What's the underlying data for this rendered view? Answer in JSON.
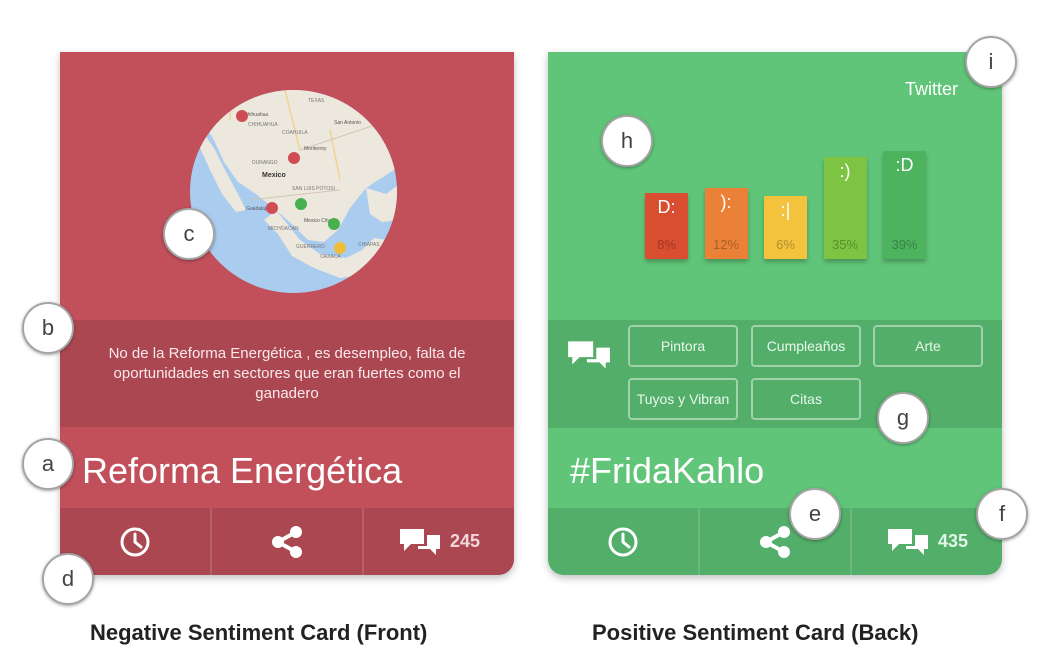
{
  "cards": {
    "negative": {
      "title": "Reforma Energética",
      "quote": "No de la Reforma Energética , es desempleo, falta de oportunidades en sectores que eran fuertes como el ganadero",
      "map_labels": [
        "Mexico",
        "TEXAS",
        "San Antonio",
        "Chihuahua",
        "CHIHUAHUA",
        "COAHUILA",
        "Monterrey",
        "DURANGO",
        "SAN LUIS POTOSI",
        "Guadalajara",
        "Mexico City",
        "MICHOACAN",
        "GUERRERO",
        "OAXACA",
        "CHIAPAS"
      ],
      "footer": {
        "count": "245"
      },
      "color": "#c1505b"
    },
    "positive": {
      "platform": "Twitter",
      "title": "#FridaKahlo",
      "sentiment": [
        {
          "face": "D:",
          "percent": "8%",
          "value": 8,
          "color": "#d94d31"
        },
        {
          "face": "):",
          "percent": "12%",
          "value": 12,
          "color": "#ea8136"
        },
        {
          "face": ":|",
          "percent": "6%",
          "value": 6,
          "color": "#f3c33e"
        },
        {
          "face": ":)",
          "percent": "35%",
          "value": 35,
          "color": "#7cc441"
        },
        {
          "face": ":D",
          "percent": "39%",
          "value": 39,
          "color": "#4eb35f"
        }
      ],
      "tags": [
        "Pintora",
        "Cumpleaños",
        "Arte",
        "Tuyos y Vibran",
        "Citas"
      ],
      "footer": {
        "count": "435"
      },
      "color": "#60c579"
    }
  },
  "markers": [
    "a",
    "b",
    "c",
    "d",
    "e",
    "f",
    "g",
    "h",
    "i"
  ],
  "captions": {
    "negative": "Negative Sentiment Card (Front)",
    "positive": "Positive Sentiment Card (Back)"
  }
}
